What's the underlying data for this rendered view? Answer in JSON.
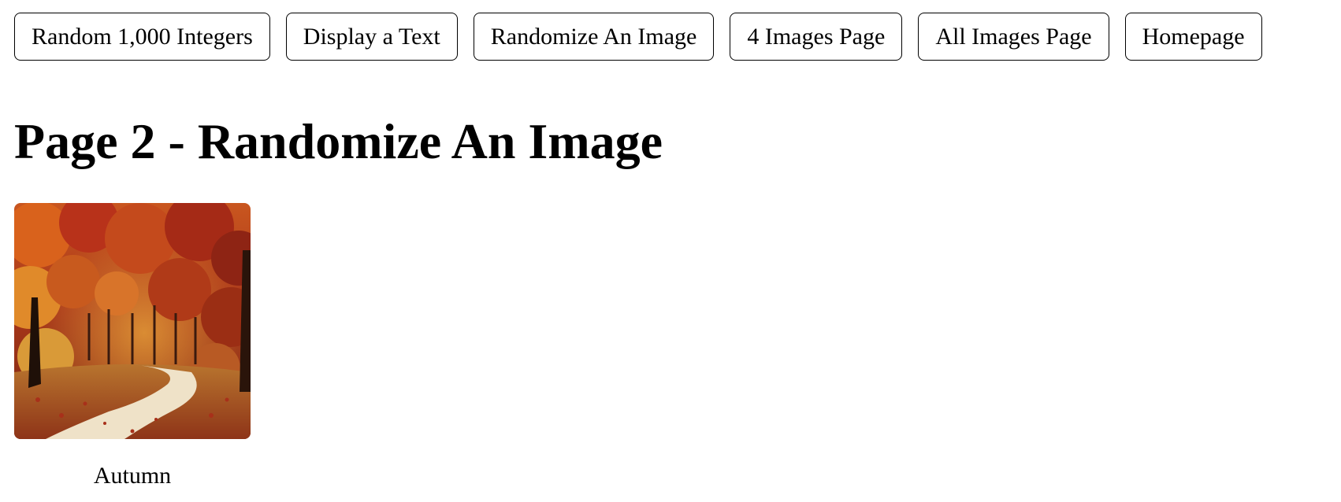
{
  "nav": {
    "buttons": [
      {
        "label": "Random 1,000 Integers"
      },
      {
        "label": "Display a Text"
      },
      {
        "label": "Randomize An Image"
      },
      {
        "label": "4 Images Page"
      },
      {
        "label": "All Images Page"
      },
      {
        "label": "Homepage"
      }
    ]
  },
  "page": {
    "title": "Page 2 - Randomize An Image"
  },
  "image": {
    "caption": "Autumn",
    "alt": "Autumn"
  }
}
